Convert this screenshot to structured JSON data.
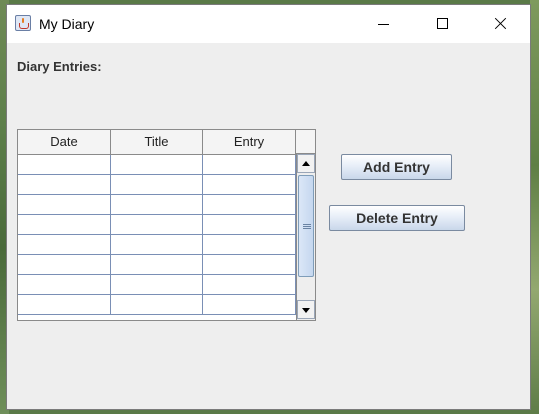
{
  "window": {
    "title": "My Diary",
    "icon": "java-cup-icon"
  },
  "label": {
    "text": "Diary Entries:"
  },
  "table": {
    "columns": [
      "Date",
      "Title",
      "Entry"
    ],
    "rows": [
      [
        "",
        "",
        ""
      ],
      [
        "",
        "",
        ""
      ],
      [
        "",
        "",
        ""
      ],
      [
        "",
        "",
        ""
      ],
      [
        "",
        "",
        ""
      ],
      [
        "",
        "",
        ""
      ],
      [
        "",
        "",
        ""
      ],
      [
        "",
        "",
        ""
      ]
    ]
  },
  "buttons": {
    "add": "Add Entry",
    "delete": "Delete Entry"
  }
}
